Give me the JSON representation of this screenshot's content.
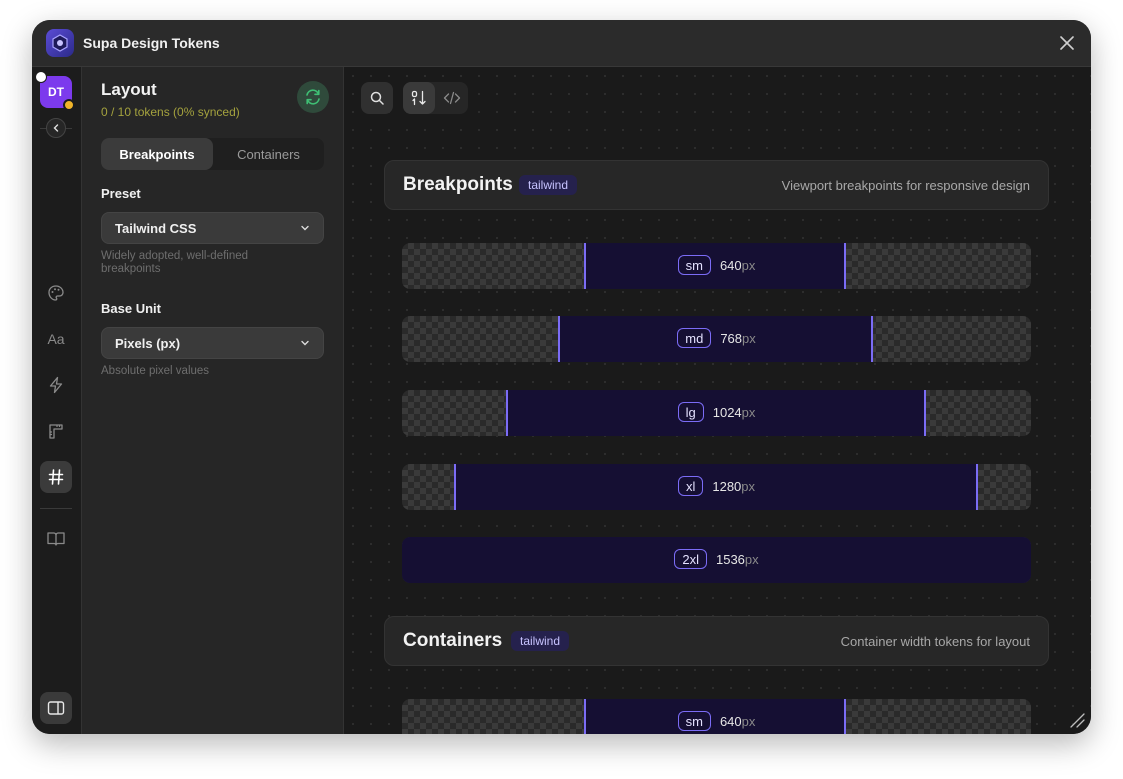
{
  "app": {
    "title": "Supa Design Tokens"
  },
  "rail": {
    "avatar_initials": "DT",
    "nav_icons": [
      "palette-icon",
      "typography-icon",
      "lightning-icon",
      "ruler-icon",
      "hash-icon",
      "book-icon"
    ],
    "active_icon": "hash-icon",
    "typography_glyph": "Aa"
  },
  "sidebar": {
    "title": "Layout",
    "subtitle": "0 / 10 tokens (0% synced)",
    "tabs": [
      {
        "label": "Breakpoints",
        "active": true
      },
      {
        "label": "Containers",
        "active": false
      }
    ],
    "preset": {
      "label": "Preset",
      "value": "Tailwind CSS",
      "help": "Widely adopted, well-defined breakpoints"
    },
    "base_unit": {
      "label": "Base Unit",
      "value": "Pixels (px)",
      "help": "Absolute pixel values"
    }
  },
  "main": {
    "sections": [
      {
        "title": "Breakpoints",
        "badge": "tailwind",
        "description": "Viewport breakpoints for responsive design",
        "items": [
          {
            "name": "sm",
            "value": "640",
            "unit": "px"
          },
          {
            "name": "md",
            "value": "768",
            "unit": "px"
          },
          {
            "name": "lg",
            "value": "1024",
            "unit": "px"
          },
          {
            "name": "xl",
            "value": "1280",
            "unit": "px"
          },
          {
            "name": "2xl",
            "value": "1536",
            "unit": "px"
          }
        ]
      },
      {
        "title": "Containers",
        "badge": "tailwind",
        "description": "Container width tokens for layout",
        "items": [
          {
            "name": "sm",
            "value": "640",
            "unit": "px"
          }
        ]
      }
    ]
  },
  "colors": {
    "accent": "#7b6cf6",
    "bar_fill": "#150f33",
    "sync_green": "#3fbf74",
    "avatar": "#7c3aed",
    "subtitle": "#a4a23e"
  }
}
